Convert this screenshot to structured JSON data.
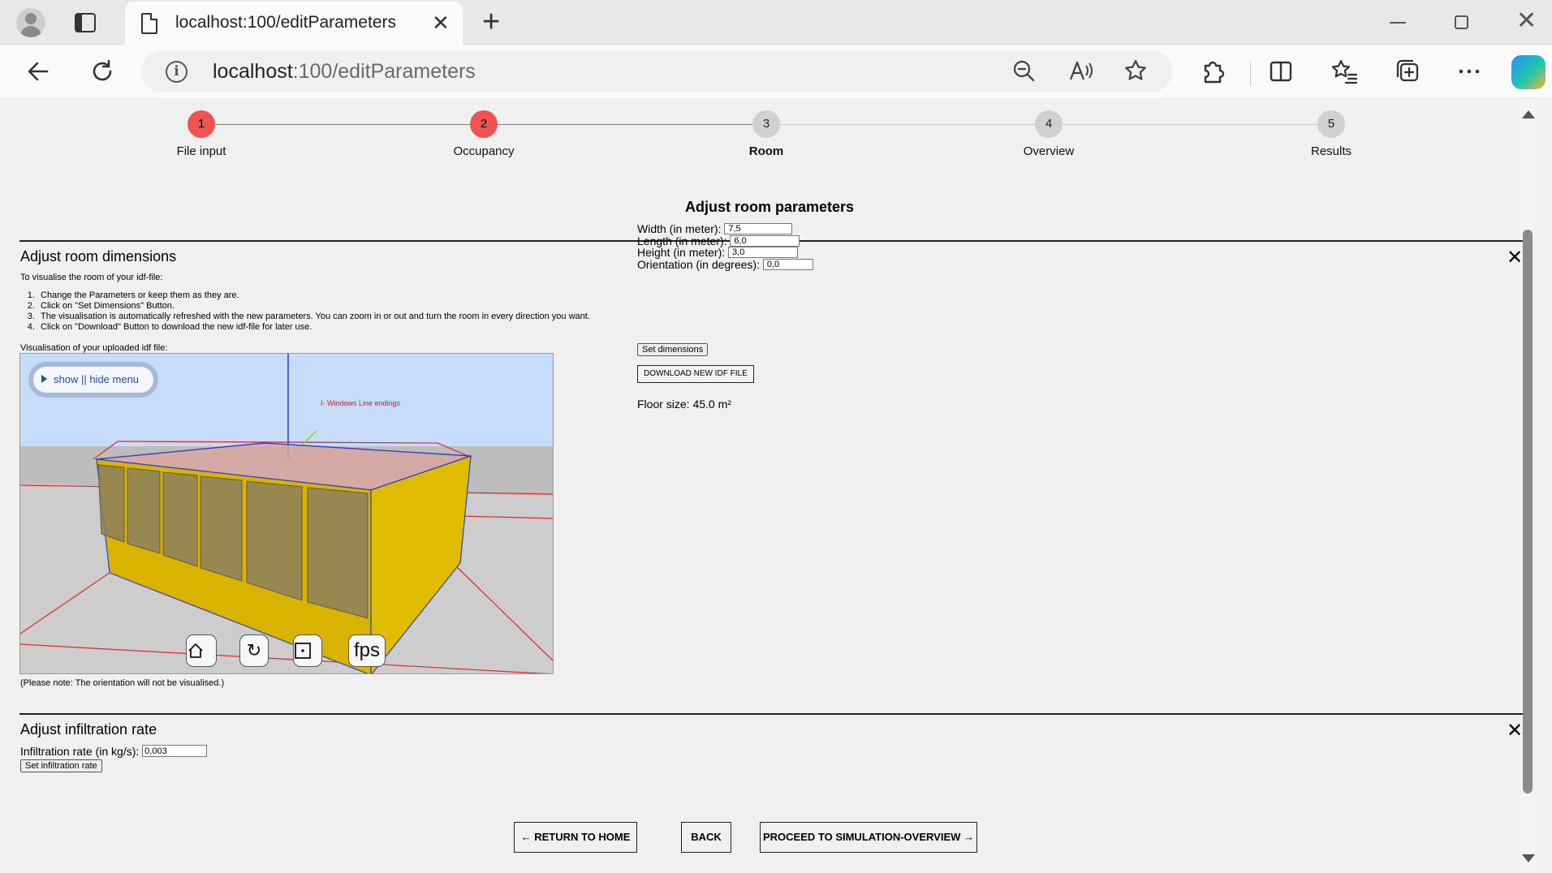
{
  "browser": {
    "tab_title": "localhost:100/editParameters",
    "new_tab_glyph": "+",
    "close_glyph": "✕",
    "url_host": "localhost",
    "url_path": ":100/editParameters",
    "icons": [
      "profile-icon",
      "tab-actions-icon",
      "page-icon",
      "back-icon",
      "refresh-icon",
      "info-icon",
      "zoom-out-icon",
      "read-aloud-icon",
      "favorite-star-icon",
      "extensions-icon",
      "split-screen-icon",
      "favorites-icon",
      "collections-icon",
      "more-icon",
      "copilot-icon"
    ]
  },
  "stepper": {
    "steps": [
      {
        "number": "1",
        "label": "File input",
        "state": "done"
      },
      {
        "number": "2",
        "label": "Occupancy",
        "state": "done"
      },
      {
        "number": "3",
        "label": "Room",
        "state": "current"
      },
      {
        "number": "4",
        "label": "Overview",
        "state": "todo"
      },
      {
        "number": "5",
        "label": "Results",
        "state": "todo"
      }
    ],
    "done_color": "#f05252",
    "todo_color": "#d0d0d0"
  },
  "page_title": "Adjust room parameters",
  "dimensions": {
    "title": "Adjust room dimensions",
    "close": "✕",
    "intro": "To visualise the room of your idf-file:",
    "instructions": [
      "Change the Parameters or keep them as they are.",
      "Click on \"Set Dimensions\" Button.",
      "The visualisation is automatically refreshed with the new parameters. You can zoom in or out and turn the room in every direction you want.",
      "Click on \"Download\" Button to download the new idf-file for later use."
    ],
    "vis_label": "Visualisation of your uploaded idf file:",
    "viewer": {
      "menu_label": "show || hide menu",
      "overlay_text": "I- Windows Line endings",
      "controls": [
        "home-icon",
        "rotate-icon",
        "fit-icon"
      ],
      "fps_label": "fps"
    },
    "note": "(Please note: The orientation will not be visualised.)",
    "fields": [
      {
        "label": "Width (in meter):",
        "value": "7,5"
      },
      {
        "label": "Length (in meter):",
        "value": "6,0"
      },
      {
        "label": "Height (in meter):",
        "value": "3,0"
      },
      {
        "label": "Orientation (in degrees):",
        "value": "0,0"
      }
    ],
    "set_button": "Set dimensions",
    "download_button": "DOWNLOAD NEW IDF FILE",
    "floor_size": "Floor size: 45.0 m²"
  },
  "infiltration": {
    "title": "Adjust infiltration rate",
    "close": "✕",
    "label": "Infiltration rate (in kg/s):",
    "value": "0,003",
    "set_button": "Set infiltration rate"
  },
  "nav": {
    "home": "← RETURN TO HOME",
    "back": "BACK",
    "proceed": "PROCEED TO SIMULATION-OVERVIEW →"
  }
}
